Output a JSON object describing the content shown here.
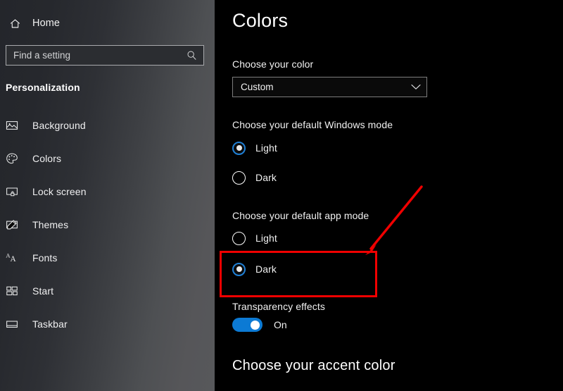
{
  "sidebar": {
    "home": {
      "label": "Home",
      "icon": "home-icon"
    },
    "search": {
      "placeholder": "Find a setting",
      "value": "",
      "icon": "search-icon"
    },
    "section_title": "Personalization",
    "items": [
      {
        "label": "Background",
        "icon": "image-icon"
      },
      {
        "label": "Colors",
        "icon": "palette-icon"
      },
      {
        "label": "Lock screen",
        "icon": "lock-screen-icon"
      },
      {
        "label": "Themes",
        "icon": "themes-brush-icon"
      },
      {
        "label": "Fonts",
        "icon": "fonts-aa-icon"
      },
      {
        "label": "Start",
        "icon": "start-tiles-icon"
      },
      {
        "label": "Taskbar",
        "icon": "taskbar-icon"
      }
    ]
  },
  "main": {
    "page_title": "Colors",
    "choose_color": {
      "label": "Choose your color",
      "selected": "Custom",
      "chevron_icon": "chevron-down-icon"
    },
    "windows_mode": {
      "label": "Choose your default Windows mode",
      "options": [
        {
          "label": "Light",
          "checked": true
        },
        {
          "label": "Dark",
          "checked": false
        }
      ]
    },
    "app_mode": {
      "label": "Choose your default app mode",
      "options": [
        {
          "label": "Light",
          "checked": false
        },
        {
          "label": "Dark",
          "checked": true
        }
      ]
    },
    "transparency": {
      "label": "Transparency effects",
      "state": "On",
      "enabled": true
    },
    "accent_heading": "Choose your accent color"
  },
  "annotations": {
    "highlight_color": "#f00000",
    "box_target": "app-mode-dark-option",
    "arrow_target": "app-mode-dark-option"
  },
  "colors": {
    "accent_blue": "#0c7ad4",
    "radio_ring": "#1f7fd4",
    "background": "#000000",
    "sidebar_dark": "#24262b",
    "sidebar_light": "#57585b",
    "annotation_red": "#f00000"
  }
}
